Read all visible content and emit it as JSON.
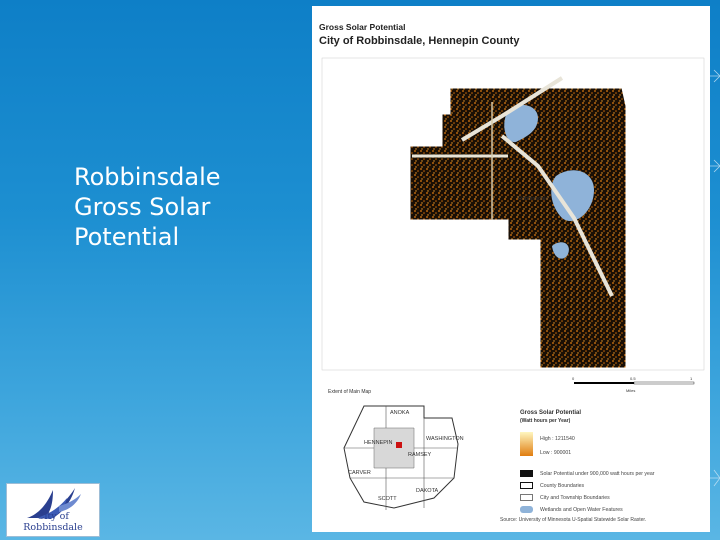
{
  "slide": {
    "title_lines": [
      "Robbinsdale",
      "Gross Solar",
      "Potential"
    ]
  },
  "logo": {
    "text": "City of Robbinsdale",
    "icon": "bird-logo-icon",
    "color": "#2a3f8f"
  },
  "map": {
    "title_line1": "Gross Solar Potential",
    "title_line2": "City of Robbinsdale, Hennepin County",
    "city_label": "Robbinsdale",
    "scale_labels": [
      "0",
      "0.5",
      "1",
      "Miles"
    ]
  },
  "inset": {
    "title": "Extent of Main Map",
    "county_labels": [
      "ANOKA",
      "HENNEPIN",
      "WASHINGTON",
      "SCOTT",
      "RAMSEY",
      "DAKOTA",
      "CARVER"
    ]
  },
  "legend": {
    "title": "Gross Solar Potential",
    "subtitle": "(Watt hours per Year)",
    "high": "High : 1211540",
    "low": "Low : 900001",
    "items": [
      "Solar Potential under 900,000 watt hours per year",
      "County Boundaries",
      "City and Township Boundaries",
      "Wetlands and Open Water Features"
    ],
    "colors": {
      "high": "#fff7c0",
      "low": "#e07d10",
      "under": "#111111",
      "water": "#8fb3d9"
    }
  },
  "source": "Source: University of Minnesota U-Spatial Statewide Solar Raster."
}
